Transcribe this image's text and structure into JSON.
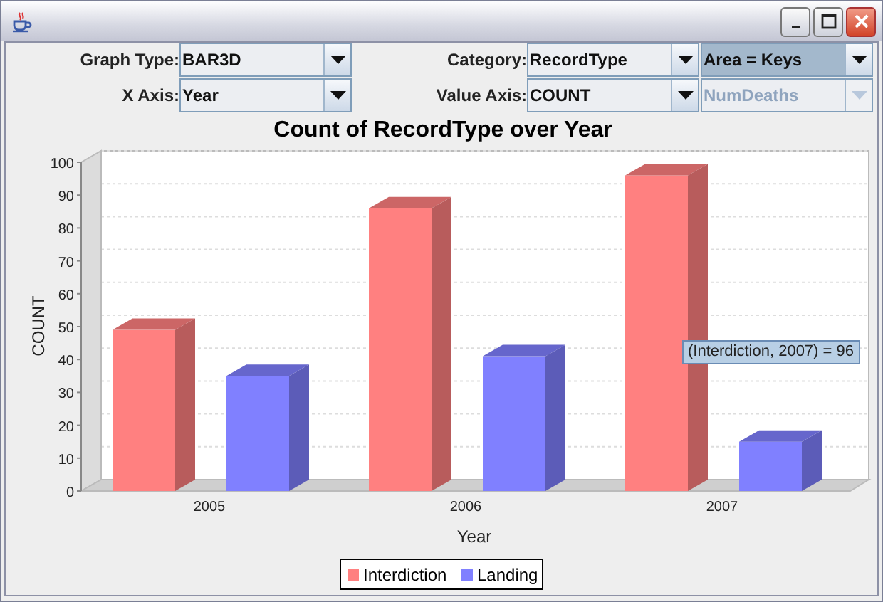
{
  "filter_rows": [
    {
      "left": {
        "label": "Graph Type:",
        "value": "BAR3D"
      },
      "right": {
        "label": "Category:",
        "value": "RecordType"
      },
      "extra": {
        "value": "Area = Keys",
        "focused": true,
        "disabled": false
      }
    },
    {
      "left": {
        "label": "X Axis:",
        "value": "Year"
      },
      "right": {
        "label": "Value Axis:",
        "value": "COUNT"
      },
      "extra": {
        "value": "NumDeaths",
        "focused": false,
        "disabled": true
      }
    }
  ],
  "chart": {
    "tooltip": "(Interdiction, 2007) = 96",
    "chart_data": {
      "type": "bar",
      "title": "Count of RecordType over Year",
      "xlabel": "Year",
      "ylabel": "COUNT",
      "categories": [
        "2005",
        "2006",
        "2007"
      ],
      "series": [
        {
          "name": "Interdiction",
          "color": "#ff8080",
          "values": [
            49,
            86,
            96
          ]
        },
        {
          "name": "Landing",
          "color": "#8080ff",
          "values": [
            35,
            41,
            15
          ]
        }
      ],
      "legend": true,
      "ylim": [
        0,
        100
      ],
      "yticks": [
        0,
        10,
        20,
        30,
        40,
        50,
        60,
        70,
        80,
        90,
        100
      ]
    }
  }
}
